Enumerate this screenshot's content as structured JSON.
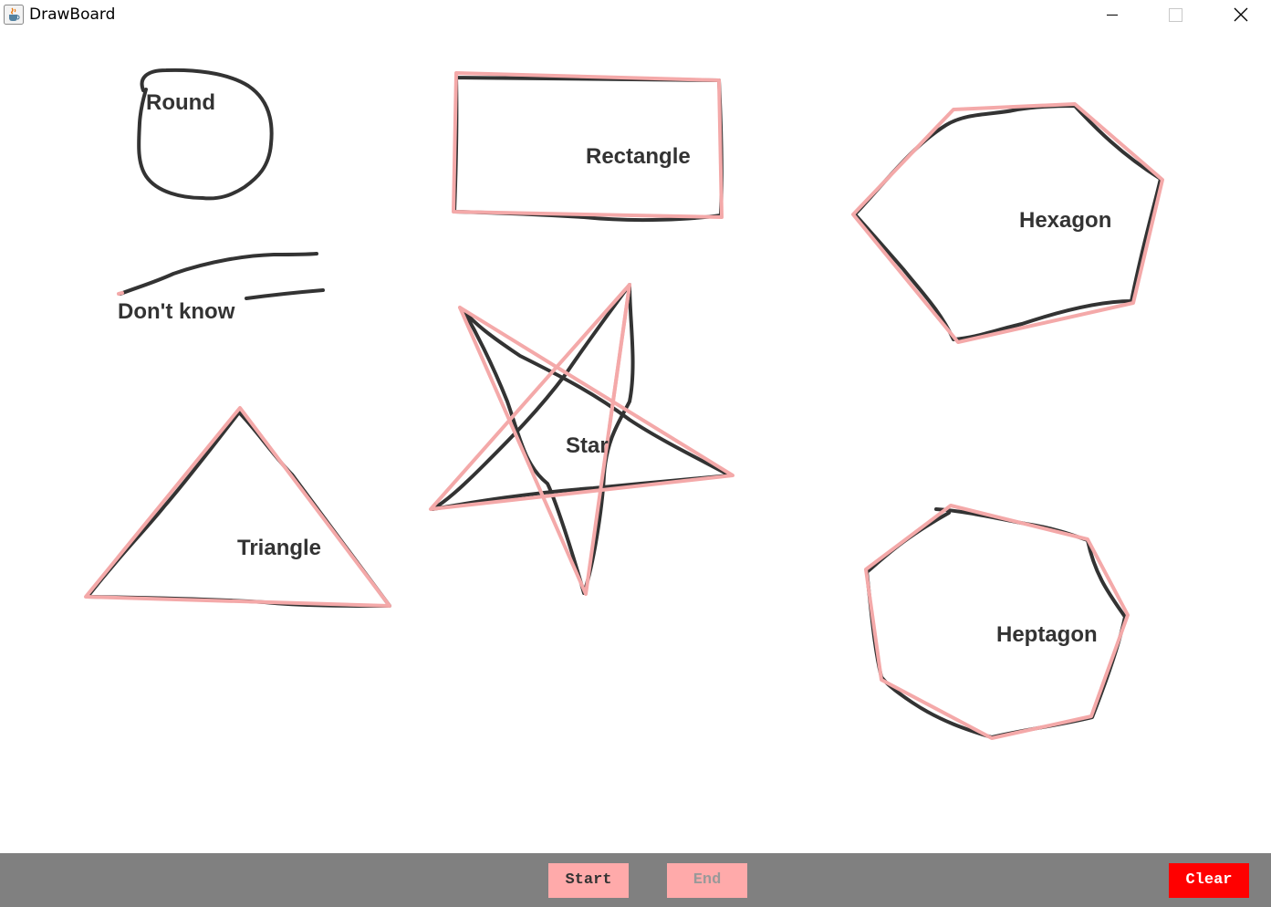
{
  "window": {
    "title": "DrawBoard",
    "icon": "java-cup-icon",
    "controls": [
      "minimize-icon",
      "maximize-icon",
      "close-icon"
    ]
  },
  "canvas": {
    "labels": {
      "round": "Round",
      "rectangle": "Rectangle",
      "hexagon": "Hexagon",
      "dont_know": "Don't know",
      "star": "Star",
      "triangle": "Triangle",
      "heptagon": "Heptagon"
    },
    "stroke_color": "#333333",
    "fit_color": "#f4a9a9"
  },
  "toolbar": {
    "start_label": "Start",
    "end_label": "End",
    "clear_label": "Clear",
    "start_color": "#ffaaaa",
    "end_color": "#ffaaaa",
    "clear_color": "#ff0000"
  }
}
